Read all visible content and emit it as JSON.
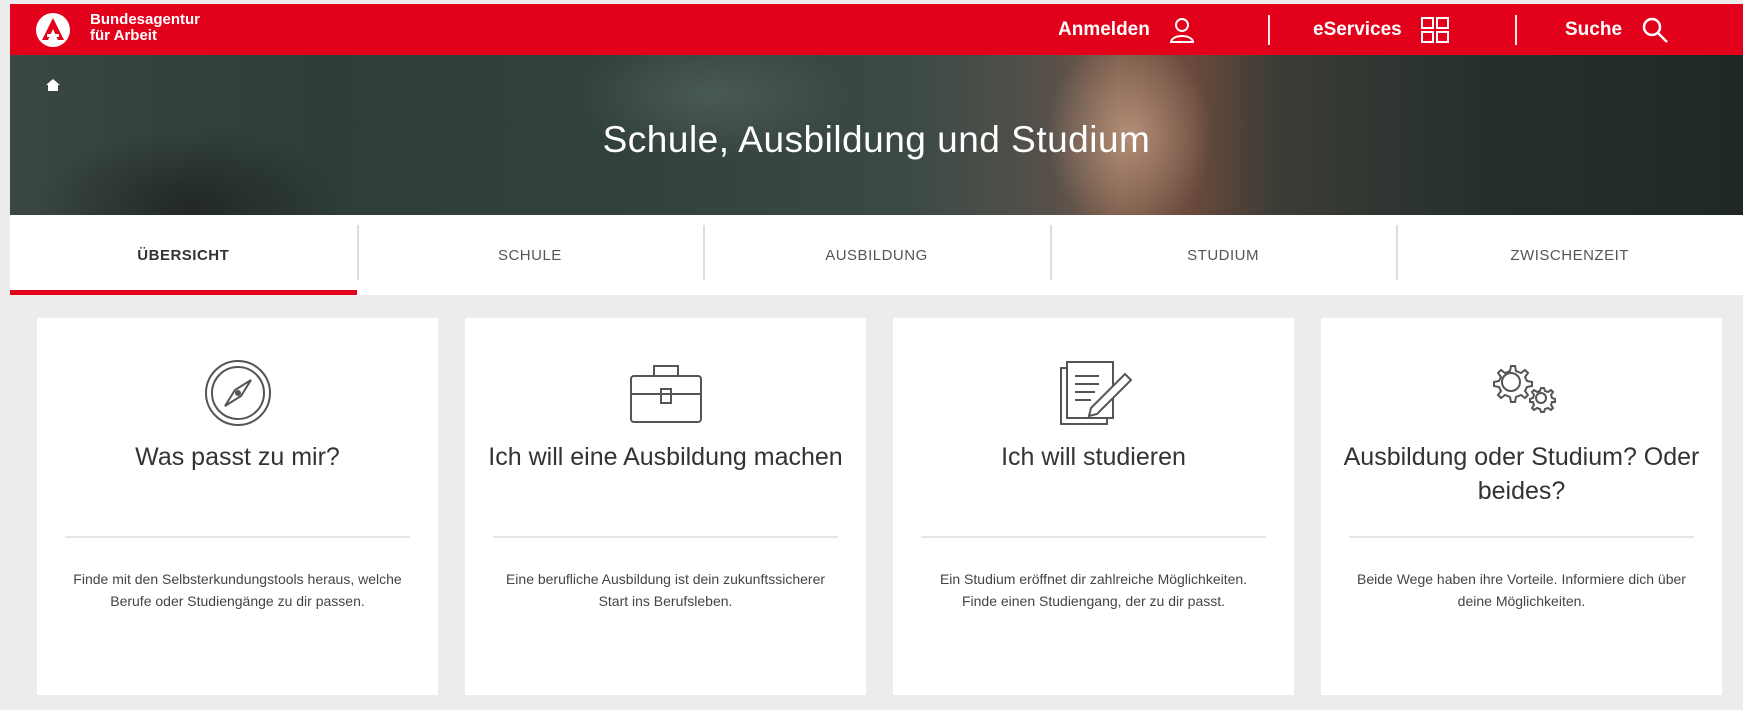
{
  "header": {
    "logo_line1": "Bundesagentur",
    "logo_line2": "für Arbeit",
    "login_label": "Anmelden",
    "eservices_label": "eServices",
    "search_label": "Suche",
    "brand_color": "#e2001a"
  },
  "hero": {
    "title": "Schule, Ausbildung und Studium"
  },
  "tabs": [
    {
      "label": "ÜBERSICHT",
      "active": true
    },
    {
      "label": "SCHULE",
      "active": false
    },
    {
      "label": "AUSBILDUNG",
      "active": false
    },
    {
      "label": "STUDIUM",
      "active": false
    },
    {
      "label": "ZWISCHENZEIT",
      "active": false
    }
  ],
  "cards": [
    {
      "icon": "compass-icon",
      "title": "Was passt zu mir?",
      "description": "Finde mit den Selbsterkundungstools heraus, welche Berufe oder Studiengänge zu dir passen."
    },
    {
      "icon": "briefcase-icon",
      "title": "Ich will eine Ausbildung machen",
      "description": "Eine berufliche Ausbildung ist dein zukunftssicherer Start ins Berufsleben."
    },
    {
      "icon": "document-pen-icon",
      "title": "Ich will studieren",
      "description": "Ein Studium eröffnet dir zahlreiche Möglichkeiten. Finde einen Studiengang, der zu dir passt."
    },
    {
      "icon": "gears-icon",
      "title": "Ausbildung oder Studium? Oder beides?",
      "description": "Beide Wege haben ihre Vorteile. Informiere dich über deine Möglichkeiten."
    }
  ]
}
